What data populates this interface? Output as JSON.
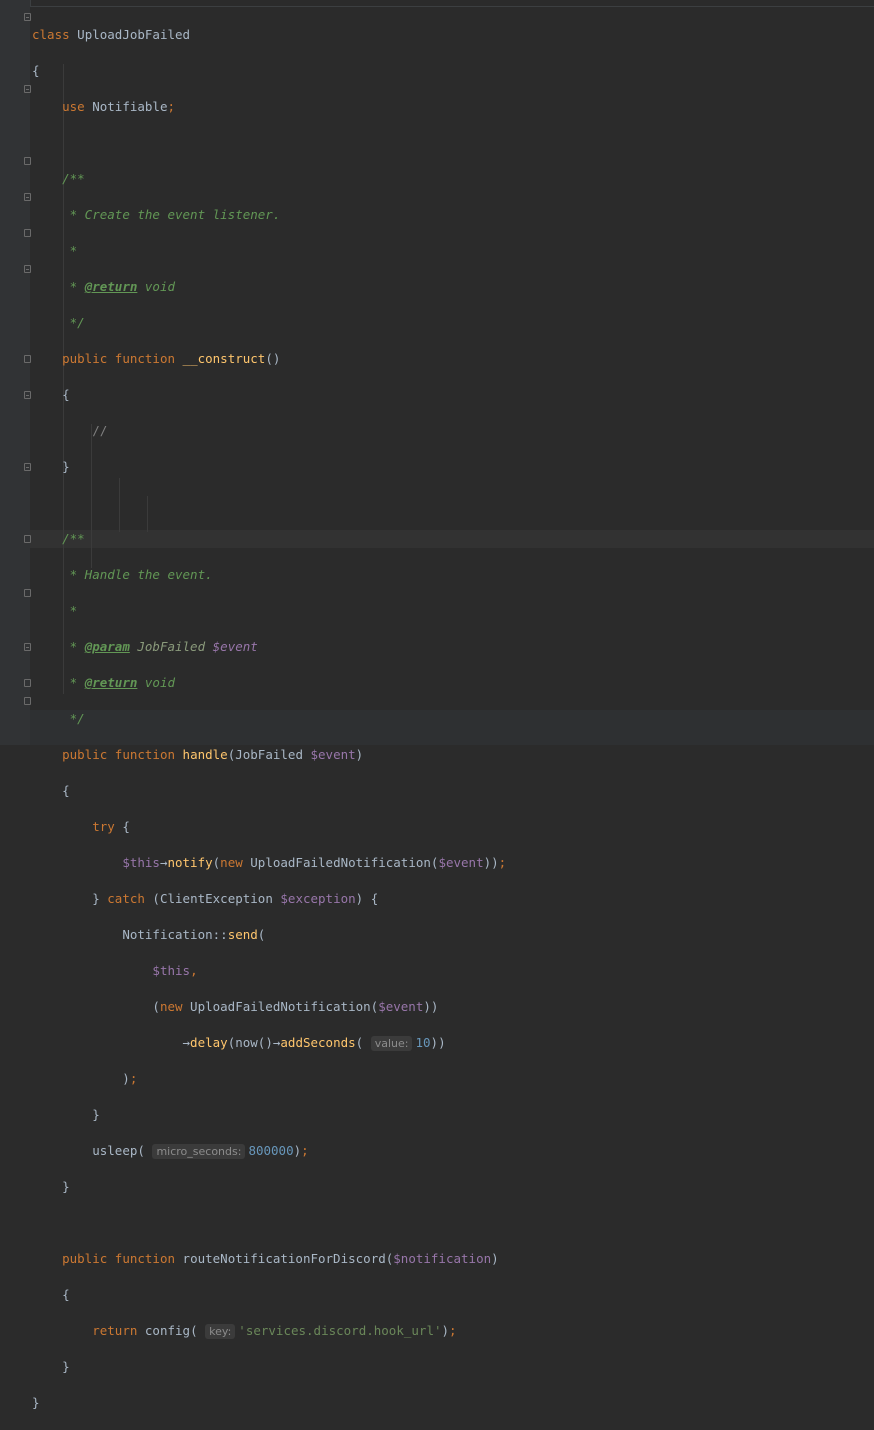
{
  "code": {
    "class_kw": "class",
    "class_name": "UploadJobFailed",
    "use_kw": "use",
    "trait": "Notifiable",
    "doc1_open": "/**",
    "doc1_text": " * Create the event listener.",
    "doc_star": " *",
    "doc_star_prefix": " * ",
    "tag_return": "@return",
    "type_void": "void",
    "doc_close": " */",
    "public_kw": "public",
    "function_kw": "function",
    "construct_name": "__construct",
    "comment_slashes": "//",
    "doc2_text": " * Handle the event.",
    "tag_param": "@param",
    "type_jobfailed": "JobFailed",
    "var_event": "$event",
    "handle_name": "handle",
    "try_kw": "try",
    "var_this": "$this",
    "notify_name": "notify",
    "new_kw": "new",
    "notification_class": "UploadFailedNotification",
    "catch_kw": "catch",
    "exception_class": "ClientException",
    "var_exception": "$exception",
    "notification_facade": "Notification",
    "send_name": "send",
    "delay_name": "delay",
    "now_fn": "now",
    "addseconds_name": "addSeconds",
    "hint_value": "value:",
    "num_ten": "10",
    "usleep_fn": "usleep",
    "hint_micro": "micro_seconds:",
    "num_micro": "800000",
    "route_name": "routeNotificationForDiscord",
    "var_notification": "$notification",
    "return_kw": "return",
    "config_fn": "config",
    "hint_key": "key:",
    "str_hook": "'services.discord.hook_url'",
    "arrow": "→"
  }
}
